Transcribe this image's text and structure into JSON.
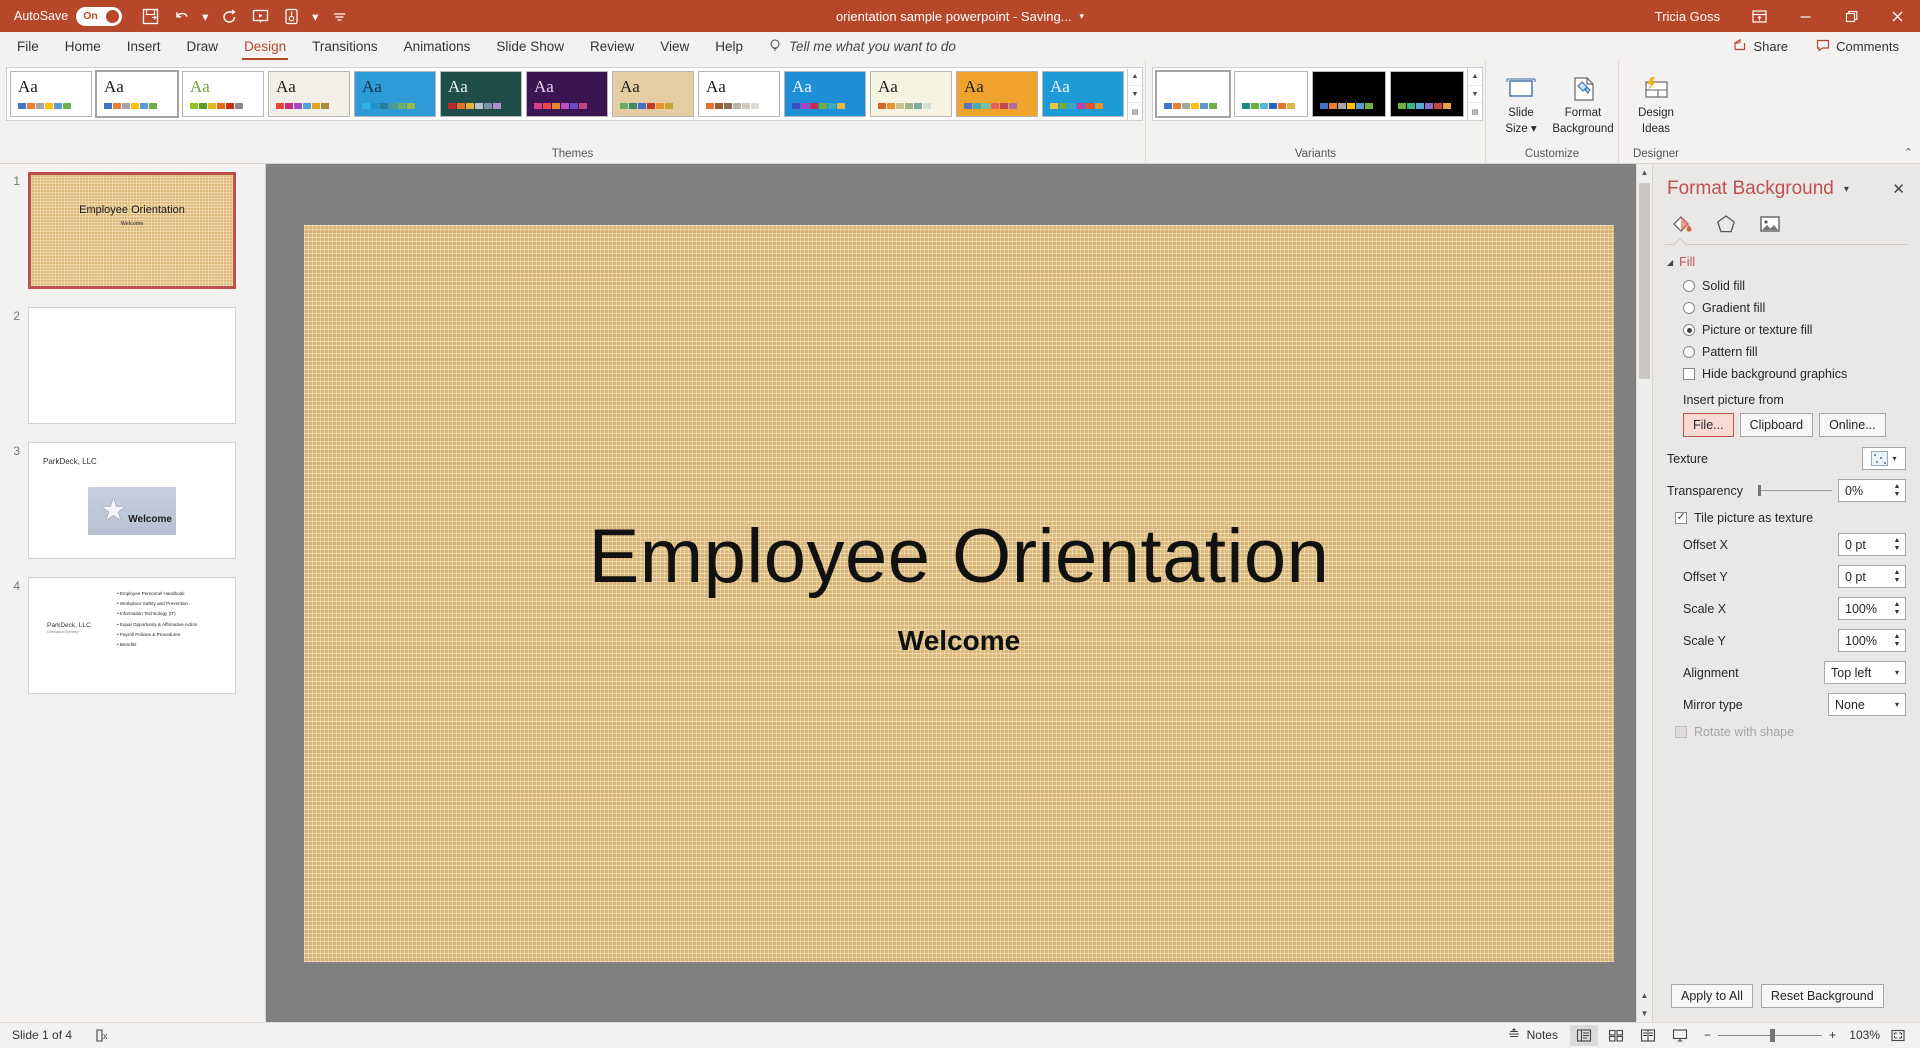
{
  "titlebar": {
    "autosave_label": "AutoSave",
    "autosave_state": "On",
    "doc_title": "orientation sample powerpoint  -  Saving...",
    "user": "Tricia Goss",
    "qat": [
      {
        "name": "save-icon",
        "tip": "Save"
      },
      {
        "name": "undo-icon",
        "tip": "Undo"
      },
      {
        "name": "redo-icon",
        "tip": "Redo"
      },
      {
        "name": "start-slideshow-icon",
        "tip": "Start From Beginning"
      },
      {
        "name": "touch-mode-icon",
        "tip": "Touch/Mouse Mode"
      },
      {
        "name": "customize-qat-icon",
        "tip": "Customize Quick Access Toolbar"
      }
    ],
    "window_buttons": [
      {
        "name": "ribbon-display-options-icon"
      },
      {
        "name": "minimize-icon"
      },
      {
        "name": "restore-icon"
      },
      {
        "name": "close-icon"
      }
    ]
  },
  "tabs": [
    {
      "label": "File",
      "active": false
    },
    {
      "label": "Home",
      "active": false
    },
    {
      "label": "Insert",
      "active": false
    },
    {
      "label": "Draw",
      "active": false
    },
    {
      "label": "Design",
      "active": true
    },
    {
      "label": "Transitions",
      "active": false
    },
    {
      "label": "Animations",
      "active": false
    },
    {
      "label": "Slide Show",
      "active": false
    },
    {
      "label": "Review",
      "active": false
    },
    {
      "label": "View",
      "active": false
    },
    {
      "label": "Help",
      "active": false
    }
  ],
  "tellme": {
    "placeholder": "Tell me what you want to do"
  },
  "header_actions": {
    "share_label": "Share",
    "comments_label": "Comments"
  },
  "ribbon": {
    "groups": {
      "themes_label": "Themes",
      "variants_label": "Variants",
      "customize_label": "Customize",
      "designer_label": "Designer"
    },
    "themes": [
      {
        "name": "office-theme",
        "selected": false,
        "bg": "#ffffff",
        "aa_color": "#1d1d1d",
        "swatches": [
          "#4472c4",
          "#ed7d31",
          "#a5a5a5",
          "#ffc000",
          "#5b9bd5",
          "#70ad47"
        ]
      },
      {
        "name": "office-theme-2",
        "selected": true,
        "bg": "#ffffff",
        "aa_color": "#1d1d1d",
        "swatches": [
          "#4472c4",
          "#ed7d31",
          "#a5a5a5",
          "#ffc000",
          "#5b9bd5",
          "#70ad47"
        ]
      },
      {
        "name": "facet-theme",
        "selected": false,
        "bg": "#ffffff",
        "aa_color": "#77a033",
        "swatches": [
          "#90c226",
          "#54a021",
          "#e6b91e",
          "#e76618",
          "#c42f19",
          "#918485"
        ]
      },
      {
        "name": "wisp-theme",
        "selected": false,
        "bg": "#f2efe9",
        "aa_color": "#1d1d1d",
        "swatches": [
          "#e8443a",
          "#c7297e",
          "#9b4fc0",
          "#55a3d6",
          "#e3a21a",
          "#b08a3e"
        ]
      },
      {
        "name": "damask-theme",
        "selected": false,
        "bg": "#2e9bd6",
        "aa_color": "#11334d",
        "swatches": [
          "#29b6e8",
          "#1e94c4",
          "#2a7f9e",
          "#4f9b8f",
          "#6fae6a",
          "#9ab84a"
        ]
      },
      {
        "name": "dividend-theme",
        "selected": false,
        "bg": "#1f4e4a",
        "aa_color": "#e8f3f1",
        "swatches": [
          "#c0272d",
          "#e86f28",
          "#e8b33c",
          "#b9c2cc",
          "#7f8fa6",
          "#b08fd0"
        ]
      },
      {
        "name": "berlin-theme",
        "selected": false,
        "bg": "#3b1452",
        "aa_color": "#e6d4f0",
        "swatches": [
          "#d63e8c",
          "#e8454c",
          "#e88a2c",
          "#b254c8",
          "#6f46c8",
          "#c3437e"
        ]
      },
      {
        "name": "wood-type-theme",
        "selected": false,
        "bg": "#e4cda2",
        "aa_color": "#1d1d1d",
        "swatches": [
          "#6fa86f",
          "#3f8a6f",
          "#4472c4",
          "#c0392b",
          "#e8932c",
          "#c9a227"
        ]
      },
      {
        "name": "ion-boardroom-theme",
        "selected": false,
        "bg": "#ffffff",
        "aa_color": "#1d1d1d",
        "swatches": [
          "#e8732c",
          "#a5572c",
          "#8a6a55",
          "#b9b2a8",
          "#cfc9c0",
          "#e0dbd4"
        ]
      },
      {
        "name": "celestial-theme",
        "selected": false,
        "bg": "#1e8fd6",
        "aa_color": "#eaf6ff",
        "swatches": [
          "#3b4fc4",
          "#b03ec4",
          "#c42f5a",
          "#6fae3e",
          "#3ea8c4",
          "#e8b93c"
        ]
      },
      {
        "name": "quotable-theme",
        "selected": false,
        "bg": "#f6f3e1",
        "aa_color": "#1d1d1d",
        "swatches": [
          "#d4622c",
          "#e8922c",
          "#c9c18f",
          "#9fb38a",
          "#7fae9e",
          "#cfe0d4"
        ]
      },
      {
        "name": "badge-theme",
        "selected": false,
        "bg": "#f0a32c",
        "aa_color": "#1d1d1d",
        "swatches": [
          "#5b6fc4",
          "#3eb0c4",
          "#6fc4a8",
          "#e8615a",
          "#c4484f",
          "#b06fa8"
        ]
      },
      {
        "name": "frame-theme",
        "selected": false,
        "bg": "#1e9bd6",
        "aa_color": "#eaf6ff",
        "swatches": [
          "#e8c73c",
          "#6fae3e",
          "#3ea8c4",
          "#c43ea8",
          "#e8532c",
          "#e8922c"
        ]
      }
    ],
    "variants": [
      {
        "name": "variant-light-1",
        "selected": true,
        "bg": "#ffffff",
        "swatches": [
          "#4472c4",
          "#ed7d31",
          "#a5a5a5",
          "#ffc000",
          "#5b9bd5",
          "#70ad47"
        ]
      },
      {
        "name": "variant-light-2",
        "selected": false,
        "bg": "#ffffff",
        "swatches": [
          "#1d8a7f",
          "#6fae3e",
          "#56b8d6",
          "#2a62b5",
          "#e8732c",
          "#e8b33c"
        ]
      },
      {
        "name": "variant-dark-1",
        "selected": false,
        "bg": "#000000",
        "swatches": [
          "#4472c4",
          "#ed7d31",
          "#a5a5a5",
          "#ffc000",
          "#5b9bd5",
          "#70ad47"
        ]
      },
      {
        "name": "variant-dark-2",
        "selected": false,
        "bg": "#000000",
        "swatches": [
          "#6fae3e",
          "#3eb08a",
          "#56a8d6",
          "#8a6fc4",
          "#c4483e",
          "#e8a33c"
        ]
      }
    ],
    "buttons": [
      {
        "name": "slide-size-button",
        "line1": "Slide",
        "line2": "Size"
      },
      {
        "name": "format-background-button",
        "line1": "Format",
        "line2": "Background"
      },
      {
        "name": "design-ideas-button",
        "line1": "Design",
        "line2": "Ideas"
      }
    ]
  },
  "slides": [
    {
      "number": "1",
      "active": true,
      "type": "title",
      "title": "Employee Orientation",
      "subtitle": "Welcome"
    },
    {
      "number": "2",
      "active": false,
      "type": "blank"
    },
    {
      "number": "3",
      "active": false,
      "type": "image",
      "corp": "ParkDeck, LLC",
      "image_caption": "Welcome"
    },
    {
      "number": "4",
      "active": false,
      "type": "bullets",
      "corp": "ParkDeck, LLC",
      "corp_sub": "Orientation Overview",
      "bullets": [
        "Employee Personnel Handbook",
        "Workplace Safety and Prevention",
        "Information Technology (IT)",
        "Equal Opportunity & Affirmative Action",
        "Payroll Policies & Procedures",
        "Benefits"
      ]
    }
  ],
  "canvas": {
    "title": "Employee Orientation",
    "subtitle": "Welcome"
  },
  "format_background": {
    "title": "Format Background",
    "tabs": [
      {
        "name": "fill-tab-icon",
        "selected": true
      },
      {
        "name": "effects-tab-icon",
        "selected": false
      },
      {
        "name": "picture-tab-icon",
        "selected": false
      }
    ],
    "fill_section_label": "Fill",
    "fill_options": [
      {
        "label": "Solid fill",
        "underline": "S",
        "selected": false
      },
      {
        "label": "Gradient fill",
        "underline": "G",
        "selected": false
      },
      {
        "label": "Picture or texture fill",
        "underline": "P",
        "selected": true
      },
      {
        "label": "Pattern fill",
        "underline": "a",
        "selected": false
      }
    ],
    "hide_bg_label": "Hide background graphics",
    "hide_bg_checked": false,
    "insert_picture_from_label": "Insert picture from",
    "insert_buttons": [
      {
        "label": "File...",
        "highlighted": true
      },
      {
        "label": "Clipboard",
        "highlighted": false
      },
      {
        "label": "Online...",
        "highlighted": false
      }
    ],
    "texture_label": "Texture",
    "transparency_label": "Transparency",
    "transparency_value": "0%",
    "tile_label": "Tile picture as texture",
    "tile_checked": true,
    "fields": [
      {
        "label": "Offset X",
        "value": "0 pt"
      },
      {
        "label": "Offset Y",
        "value": "0 pt"
      },
      {
        "label": "Scale X",
        "value": "100%"
      },
      {
        "label": "Scale Y",
        "value": "100%"
      }
    ],
    "alignment_label": "Alignment",
    "alignment_value": "Top left",
    "mirror_label": "Mirror type",
    "mirror_value": "None",
    "rotate_label": "Rotate with shape",
    "rotate_enabled": false,
    "footer_buttons": [
      {
        "label": "Apply to All"
      },
      {
        "label": "Reset Background"
      }
    ]
  },
  "statusbar": {
    "slide_counter": "Slide 1 of 4",
    "accessibility_name": "accessibility-checker-icon",
    "notes_label": "Notes",
    "views": [
      {
        "name": "normal-view-button",
        "active": true
      },
      {
        "name": "slide-sorter-view-button",
        "active": false
      },
      {
        "name": "reading-view-button",
        "active": false
      },
      {
        "name": "slide-show-button",
        "active": false
      }
    ],
    "zoom_out": "−",
    "zoom_in": "+",
    "zoom_level": "103%",
    "fit_name": "fit-slide-to-window-button"
  },
  "colors": {
    "brand": "#b7472a",
    "accent": "#c0504d",
    "ribbon_bg": "#f3f2f1",
    "canvas_bg": "#808080",
    "slide_bg": "#e6c68a"
  }
}
